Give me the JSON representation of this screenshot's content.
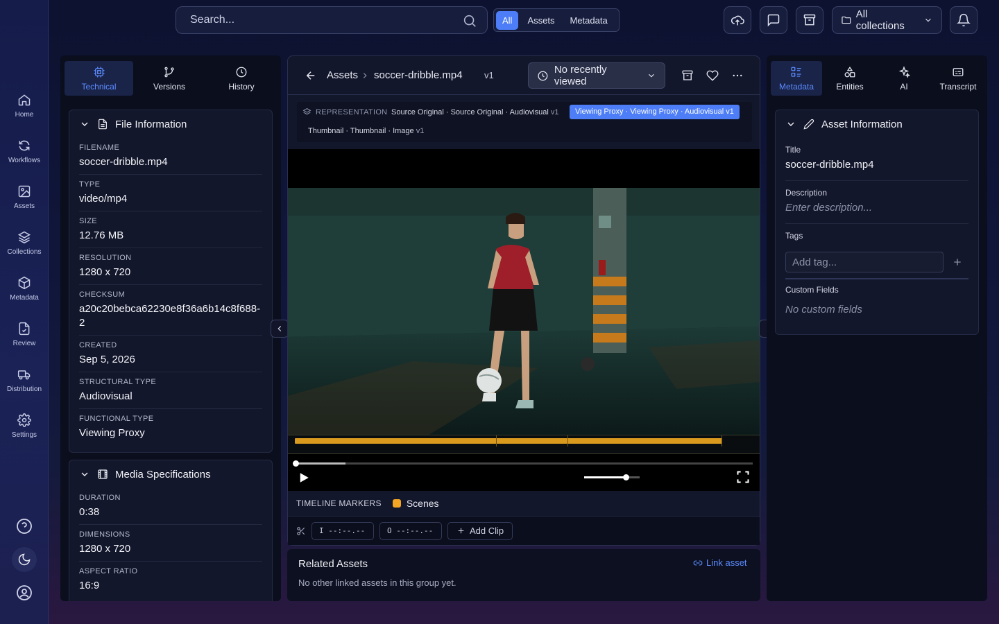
{
  "nav": {
    "items": [
      {
        "label": "Home",
        "icon": "home-icon"
      },
      {
        "label": "Workflows",
        "icon": "refresh-icon"
      },
      {
        "label": "Assets",
        "icon": "image-icon"
      },
      {
        "label": "Collections",
        "icon": "layers-icon"
      },
      {
        "label": "Metadata",
        "icon": "cube-icon"
      },
      {
        "label": "Review",
        "icon": "file-check-icon"
      },
      {
        "label": "Distribution",
        "icon": "truck-icon"
      },
      {
        "label": "Settings",
        "icon": "gear-icon"
      }
    ],
    "bottom_icons": [
      "help-icon",
      "moon-icon",
      "user-circle-icon"
    ]
  },
  "top": {
    "search_placeholder": "Search...",
    "filters": [
      "All",
      "Assets",
      "Metadata"
    ],
    "active_filter": "All",
    "collections": "All collections"
  },
  "left": {
    "tabs": [
      "Technical",
      "Versions",
      "History"
    ],
    "active_tab": "Technical",
    "file_info": {
      "title": "File Information",
      "fields": [
        {
          "label": "FILENAME",
          "value": "soccer-dribble.mp4"
        },
        {
          "label": "TYPE",
          "value": "video/mp4"
        },
        {
          "label": "SIZE",
          "value": "12.76 MB"
        },
        {
          "label": "RESOLUTION",
          "value": "1280 x 720"
        },
        {
          "label": "CHECKSUM",
          "value": "a20c20bebca62230e8f36a6b14c8f688-2"
        },
        {
          "label": "CREATED",
          "value": "Sep 5, 2026"
        },
        {
          "label": "STRUCTURAL TYPE",
          "value": "Audiovisual"
        },
        {
          "label": "FUNCTIONAL TYPE",
          "value": "Viewing Proxy"
        }
      ]
    },
    "media_specs": {
      "title": "Media Specifications",
      "fields": [
        {
          "label": "DURATION",
          "value": "0:38"
        },
        {
          "label": "DIMENSIONS",
          "value": "1280 x 720"
        },
        {
          "label": "ASPECT RATIO",
          "value": "16:9"
        }
      ]
    }
  },
  "center": {
    "breadcrumb_root": "Assets",
    "breadcrumb_file": "soccer-dribble.mp4",
    "version": "v1",
    "recent": "No recently viewed",
    "representation_label": "REPRESENTATION",
    "reps": [
      {
        "name": "Source Original · Source Original · Audiovisual",
        "ver": "v1",
        "active": false
      },
      {
        "name": "Viewing Proxy · Viewing Proxy · Audiovisual",
        "ver": "v1",
        "active": true
      },
      {
        "name": "Thumbnail · Thumbnail · Image",
        "ver": "v1",
        "active": false
      }
    ],
    "player": {
      "progress": 0.11,
      "volume": 0.75
    },
    "timeline_label": "TIMELINE MARKERS",
    "marker_name": "Scenes",
    "marker_color": "#f5a524",
    "clip_in": "I --:--.--",
    "clip_out": "O --:--.--",
    "add_clip": "Add Clip"
  },
  "related": {
    "title": "Related Assets",
    "link": "Link asset",
    "empty": "No other linked assets in this group yet."
  },
  "right": {
    "tabs": [
      "Metadata",
      "Entities",
      "AI",
      "Transcript"
    ],
    "active_tab": "Metadata",
    "title": "Asset Information",
    "title_label": "Title",
    "title_value": "soccer-dribble.mp4",
    "desc_label": "Description",
    "desc_placeholder": "Enter description...",
    "tags_label": "Tags",
    "tag_placeholder": "Add tag...",
    "custom_label": "Custom Fields",
    "custom_empty": "No custom fields"
  },
  "colors": {
    "accent": "#4d7ef7",
    "marker": "#f5a524"
  }
}
